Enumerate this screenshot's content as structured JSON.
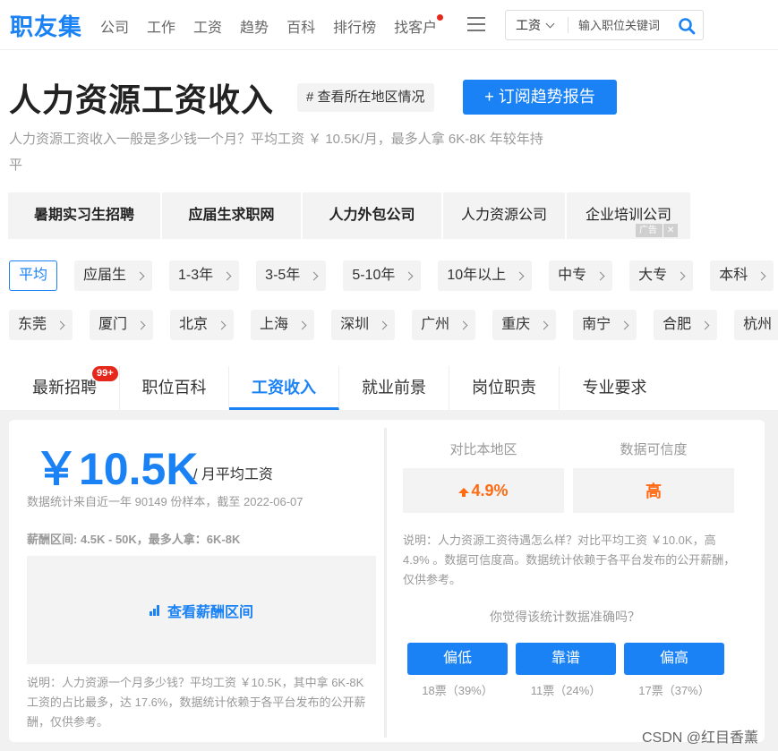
{
  "header": {
    "logo": "职友集",
    "nav": [
      "公司",
      "工作",
      "工资",
      "趋势",
      "百科",
      "排行榜",
      "找客户"
    ],
    "search": {
      "category": "工资",
      "placeholder": "输入职位关键词"
    }
  },
  "title": {
    "heading": "人力资源工资收入",
    "tag_button": "# 查看所在地区情况",
    "subscribe_button": "+ 订阅趋势报告",
    "description": "人力资源工资收入一般是多少钱一个月？平均工资 ￥ 10.5K/月，最多人拿 6K-8K 年较年持平"
  },
  "ad_tags": [
    "暑期实习生招聘",
    "应届生求职网",
    "人力外包公司",
    "人力资源公司",
    "企业培训公司"
  ],
  "ad_mark": {
    "label": "广告",
    "close": "✕"
  },
  "filters": {
    "experience": [
      "平均",
      "应届生",
      "1-3年",
      "3-5年",
      "5-10年",
      "10年以上",
      "中专",
      "大专",
      "本科"
    ],
    "cities": [
      "东莞",
      "厦门",
      "北京",
      "上海",
      "深圳",
      "广州",
      "重庆",
      "南宁",
      "合肥",
      "杭州"
    ]
  },
  "tabs": [
    {
      "label": "最新招聘",
      "badge": "99+"
    },
    {
      "label": "职位百科"
    },
    {
      "label": "工资收入",
      "active": true
    },
    {
      "label": "就业前景"
    },
    {
      "label": "岗位职责"
    },
    {
      "label": "专业要求"
    }
  ],
  "salary": {
    "amount": "￥10.5K",
    "unit": "/ 月平均工资",
    "stat_note": "数据统计来自近一年 90149 份样本，截至 2022-06-07",
    "range": "薪酬区间: 4.5K - 50K，最多人拿：6K-8K",
    "range_link": "查看薪酬区间",
    "note": "说明：人力资源一个月多少钱？平均工资 ￥10.5K，其中拿 6K-8K 工资的占比最多，达 17.6%，数据统计依赖于各平台发布的公开薪酬，仅供参考。"
  },
  "compare": {
    "local_label": "对比本地区",
    "local_value": "4.9%",
    "reliability_label": "数据可信度",
    "reliability_value": "高",
    "note": "说明：人力资源工资待遇怎么样？对比平均工资 ￥10.0K，高 4.9% 。数据可信度高。数据统计依赖于各平台发布的公开薪酬，仅供参考。",
    "question": "你觉得该统计数据准确吗？",
    "votes": [
      {
        "label": "偏低",
        "count": "18票（39%）"
      },
      {
        "label": "靠谱",
        "count": "11票（24%）"
      },
      {
        "label": "偏高",
        "count": "17票（37%）"
      }
    ]
  },
  "watermark": "CSDN @红目香薰",
  "colors": {
    "brand": "#1a82f4",
    "accent": "#ff6a13",
    "badge": "#e5281b"
  }
}
